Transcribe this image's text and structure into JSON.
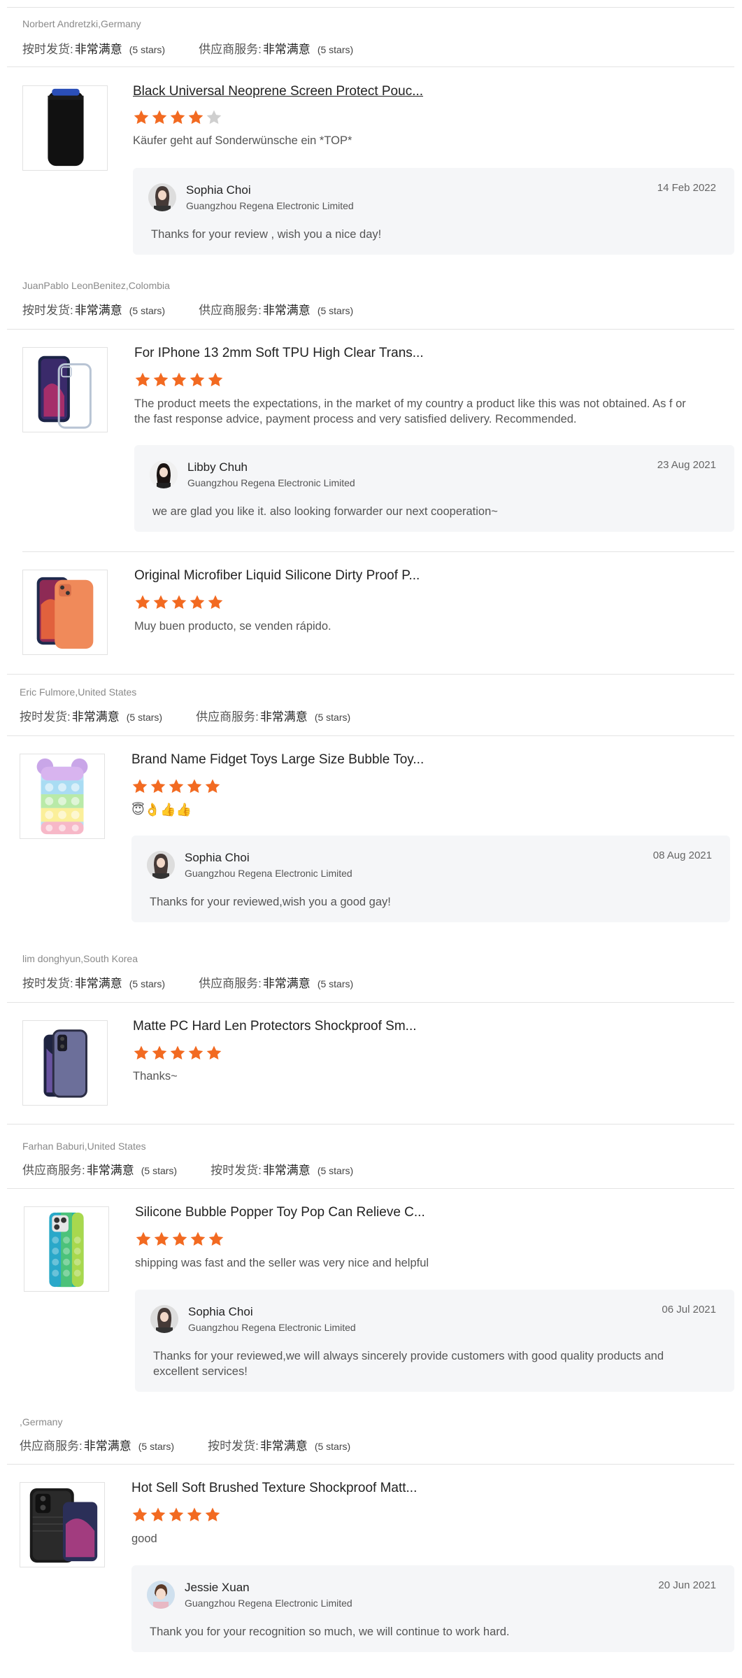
{
  "rating_labels": {
    "delivery": "按时发货:",
    "service": "供应商服务:",
    "value": "非常满意",
    "stars": "(5 stars)"
  },
  "reviewers": [
    "Norbert Andretzki,Germany",
    "JuanPablo LeonBenitez,Colombia",
    "Eric Fulmore,United States",
    "lim donghyun,South Korea",
    "Farhan Baburi,United States",
    ",Germany"
  ],
  "reviews": [
    {
      "title": "Black Universal Neoprene Screen Protect Pouc...",
      "rating": 4,
      "text": "Käufer geht auf Sonderwünsche ein *TOP*",
      "reply": {
        "name": "Sophia Choi",
        "company": "Guangzhou Regena Electronic Limited",
        "date": "14 Feb 2022",
        "message": "Thanks for your review , wish you a nice day!"
      }
    },
    {
      "title": "For IPhone 13 2mm Soft TPU High Clear Trans...",
      "rating": 5,
      "text": "The product meets the expectations, in the market of my country a product like this was not obtained.  As f or the fast response advice, payment process and very satisfied delivery.  Recommended.",
      "reply": {
        "name": "Libby Chuh",
        "company": "Guangzhou Regena Electronic Limited",
        "date": "23 Aug 2021",
        "message": "we are glad you like it. also looking forwarder our next cooperation~"
      }
    },
    {
      "title": "Original Microfiber Liquid Silicone Dirty Proof P...",
      "rating": 5,
      "text": "Muy buen producto,  se venden rápido."
    },
    {
      "title": "Brand Name Fidget Toys Large Size Bubble Toy...",
      "rating": 5,
      "text": "😇👌👍👍",
      "reply": {
        "name": "Sophia Choi",
        "company": "Guangzhou Regena Electronic Limited",
        "date": "08 Aug 2021",
        "message": "Thanks for your reviewed,wish you a good gay!"
      }
    },
    {
      "title": "Matte PC Hard Len Protectors Shockproof Sm...",
      "rating": 5,
      "text": "Thanks~"
    },
    {
      "title": "Silicone Bubble Popper Toy Pop Can Relieve C...",
      "rating": 5,
      "text": "shipping was fast and the seller was very nice and helpful",
      "reply": {
        "name": "Sophia Choi",
        "company": "Guangzhou Regena Electronic Limited",
        "date": "06 Jul 2021",
        "message": "Thanks for your reviewed,we will always sincerely provide customers with good quality products and excellent services!"
      }
    },
    {
      "title": "Hot Sell Soft Brushed Texture Shockproof Matt...",
      "rating": 5,
      "text": "good",
      "reply": {
        "name": "Jessie Xuan",
        "company": "Guangzhou Regena Electronic Limited",
        "date": "20 Jun 2021",
        "message": "Thank you for your recognition so much, we will continue to work hard."
      }
    }
  ],
  "colors": {
    "star_filled": "#f26a21",
    "star_empty": "#cfcfcf",
    "reply_bg": "#f5f6f8",
    "divider": "#e3e3e3"
  }
}
